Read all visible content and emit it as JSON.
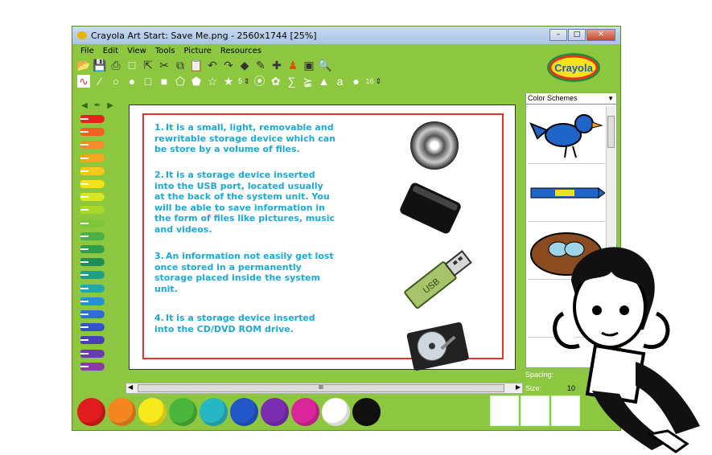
{
  "window": {
    "title": "Crayola Art Start: Save Me.png - 2560x1744 [25%]",
    "buttons": [
      "–",
      "□",
      "✕"
    ]
  },
  "menu": [
    "File",
    "Edit",
    "View",
    "Tools",
    "Picture",
    "Resources"
  ],
  "toolbar": {
    "star_points": "5",
    "brush_size": "16"
  },
  "logo_text": "Crayola",
  "right_panel": {
    "dropdown_value": "Color Schemes",
    "spacing_label": "Spacing:",
    "size_label": "Size:",
    "size_value": "10"
  },
  "canvas_items": [
    {
      "num": "1.",
      "text": "It is a small, light, removable and rewritable storage device which can be store by a volume of files."
    },
    {
      "num": "2.",
      "text": "It is a storage device inserted into the USB port, located usually at the back of the system unit. You will be able to save information in the form of files like pictures, music and videos."
    },
    {
      "num": "3.",
      "text": "An information not easily get lost once stored in a permanently storage placed inside the system unit."
    },
    {
      "num": "4.",
      "text": "It is a storage device inserted into the CD/DVD ROM drive."
    }
  ],
  "usb_label": "USB",
  "scroll_grip": "III",
  "colors": {
    "crayons": [
      "#e8201e",
      "#f0601e",
      "#f38b2a",
      "#f6a623",
      "#f5c81a",
      "#f4e11a",
      "#d9e625",
      "#a8d92a",
      "#7cc739",
      "#4bb04a",
      "#2f9e4a",
      "#1f8d56",
      "#1f9f8a",
      "#1fa7b6",
      "#2491d3",
      "#2f6fd2",
      "#3453c4",
      "#4b3fb8",
      "#6a3aae",
      "#8b38a9"
    ],
    "paint_pots": [
      "#e01c1c",
      "#f3861e",
      "#f8e81c",
      "#49b53b",
      "#27b6c4",
      "#2356c9",
      "#7b2db2",
      "#d9279b",
      "#ffffff",
      "#111111"
    ]
  }
}
